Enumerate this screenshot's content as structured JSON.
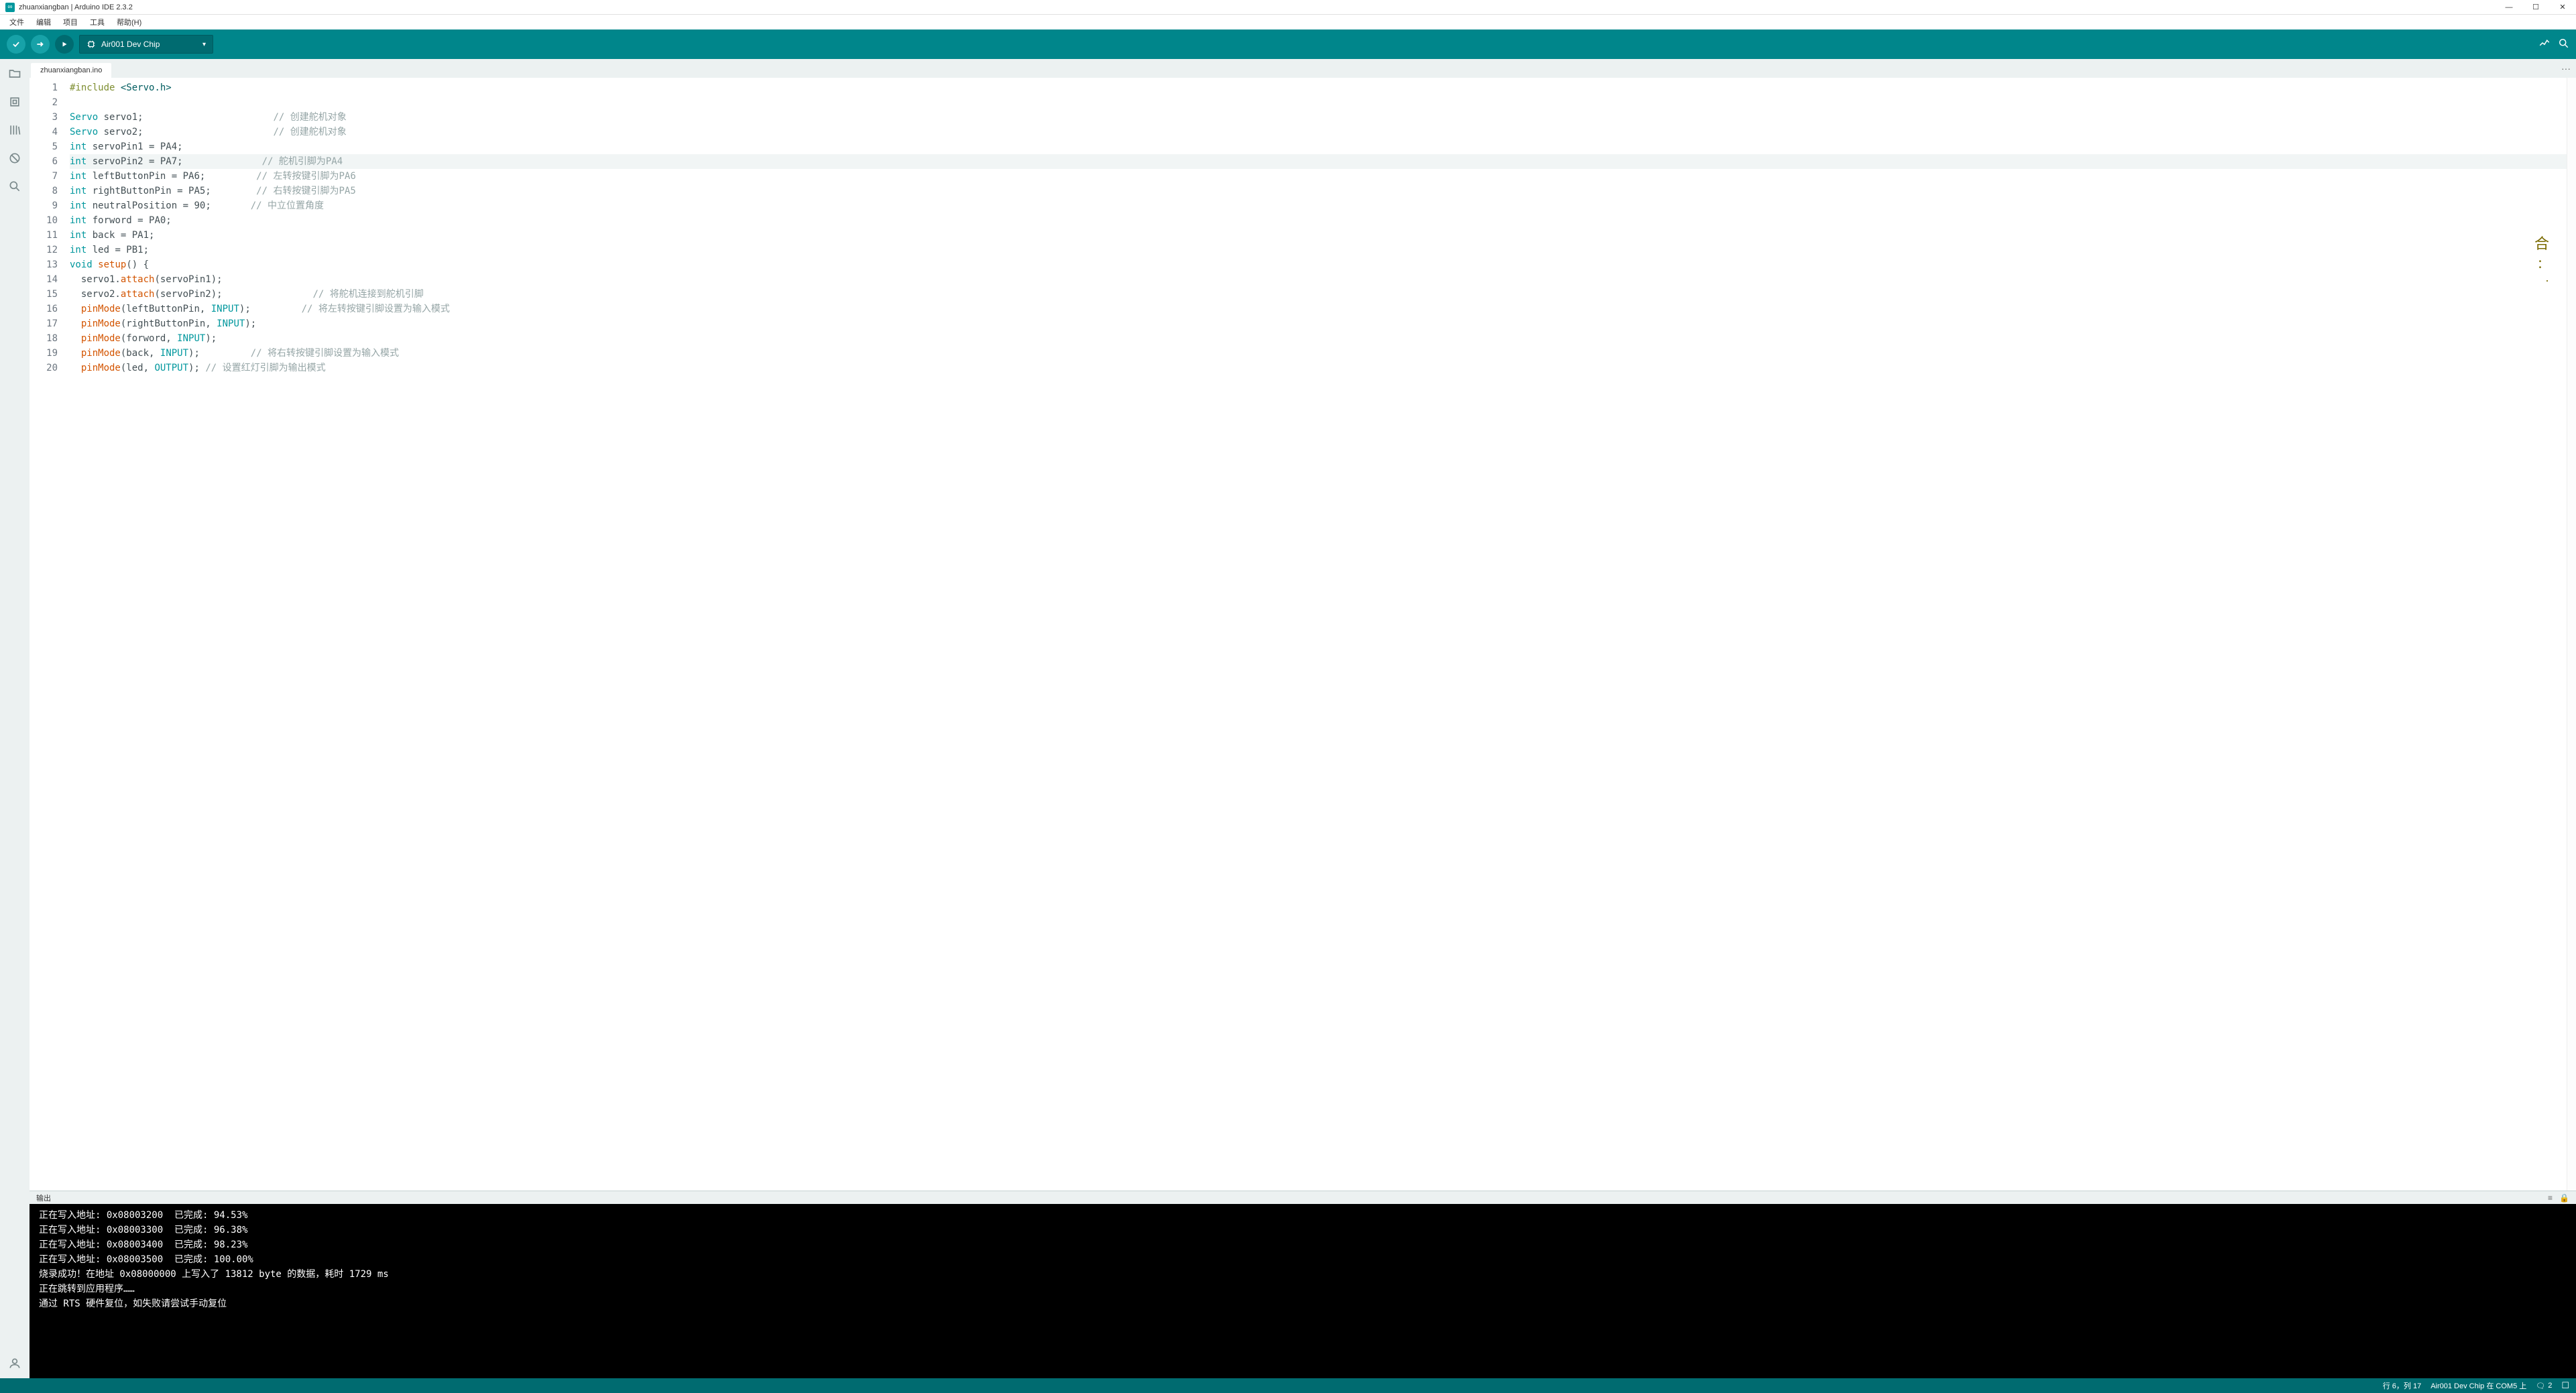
{
  "titlebar": {
    "title": "zhuanxiangban | Arduino IDE 2.3.2",
    "min": "—",
    "max": "☐",
    "close": "✕"
  },
  "menubar": {
    "file": "文件",
    "edit": "编辑",
    "project": "项目",
    "tools": "工具",
    "help": "帮助(H)"
  },
  "toolbar": {
    "board": "Air001 Dev Chip"
  },
  "tabs": {
    "main": "zhuanxiangban.ino",
    "more": "···"
  },
  "code": {
    "l1_a": "#include",
    "l1_b": " <Servo.h>",
    "l2": "",
    "l3_a": "Servo",
    "l3_b": " servo1;                       ",
    "l3_c": "// 创建舵机对象",
    "l4_a": "Servo",
    "l4_b": " servo2;                       ",
    "l4_c": "// 创建舵机对象",
    "l5_a": "int",
    "l5_b": " servoPin1 = PA4;",
    "l6_a": "int",
    "l6_b": " servoPin2 = PA7;              ",
    "l6_c": "// 舵机引脚为PA4",
    "l7_a": "int",
    "l7_b": " leftButtonPin = PA6;         ",
    "l7_c": "// 左转按键引脚为PA6",
    "l8_a": "int",
    "l8_b": " rightButtonPin = PA5;        ",
    "l8_c": "// 右转按键引脚为PA5",
    "l9_a": "int",
    "l9_b": " neutralPosition = ",
    "l9_c": "90",
    "l9_d": ";       ",
    "l9_e": "// 中立位置角度",
    "l10_a": "int",
    "l10_b": " forword = PA0;",
    "l11_a": "int",
    "l11_b": " back = PA1;",
    "l12_a": "int",
    "l12_b": " led = PB1;",
    "l13_a": "void",
    "l13_b": " ",
    "l13_c": "setup",
    "l13_d": "() {",
    "l14_a": "  servo1.",
    "l14_b": "attach",
    "l14_c": "(servoPin1);",
    "l15_a": "  servo2.",
    "l15_b": "attach",
    "l15_c": "(servoPin2);                ",
    "l15_d": "// 将舵机连接到舵机引脚",
    "l16_a": "  ",
    "l16_b": "pinMode",
    "l16_c": "(leftButtonPin, ",
    "l16_d": "INPUT",
    "l16_e": ");         ",
    "l16_f": "// 将左转按键引脚设置为输入模式",
    "l17_a": "  ",
    "l17_b": "pinMode",
    "l17_c": "(rightButtonPin, ",
    "l17_d": "INPUT",
    "l17_e": ");",
    "l18_a": "  ",
    "l18_b": "pinMode",
    "l18_c": "(forword, ",
    "l18_d": "INPUT",
    "l18_e": ");",
    "l19_a": "  ",
    "l19_b": "pinMode",
    "l19_c": "(back, ",
    "l19_d": "INPUT",
    "l19_e": ");         ",
    "l19_f": "// 将右转按键引脚设置为输入模式",
    "l20_a": "  ",
    "l20_b": "pinMode",
    "l20_c": "(led, ",
    "l20_d": "OUTPUT",
    "l20_e": "); ",
    "l20_f": "// 设置红灯引脚为输出模式"
  },
  "lines": {
    "n1": "1",
    "n2": "2",
    "n3": "3",
    "n4": "4",
    "n5": "5",
    "n6": "6",
    "n7": "7",
    "n8": "8",
    "n9": "9",
    "n10": "10",
    "n11": "11",
    "n12": "12",
    "n13": "13",
    "n14": "14",
    "n15": "15",
    "n16": "16",
    "n17": "17",
    "n18": "18",
    "n19": "19",
    "n20": "20"
  },
  "output": {
    "title": "输出",
    "l1": "正在写入地址: 0x08003200  已完成: 94.53%",
    "l2": "",
    "l3": "正在写入地址: 0x08003300  已完成: 96.38%",
    "l4": "",
    "l5": "正在写入地址: 0x08003400  已完成: 98.23%",
    "l6": "",
    "l7": "正在写入地址: 0x08003500  已完成: 100.00%",
    "l8": "烧录成功！在地址 0x08000000 上写入了 13812 byte 的数据，耗时 1729 ms",
    "l9": "",
    "l10": "正在跳转到应用程序……",
    "l11": "通过 RTS 硬件复位，如失败请尝试手动复位"
  },
  "status": {
    "cursor": "行 6，列 17",
    "board": "Air001 Dev Chip 在 COM5 上",
    "notif": "2",
    "bell": "🔔"
  },
  "ime": {
    "char": "合",
    "dots": "：",
    "dots2": "·"
  }
}
